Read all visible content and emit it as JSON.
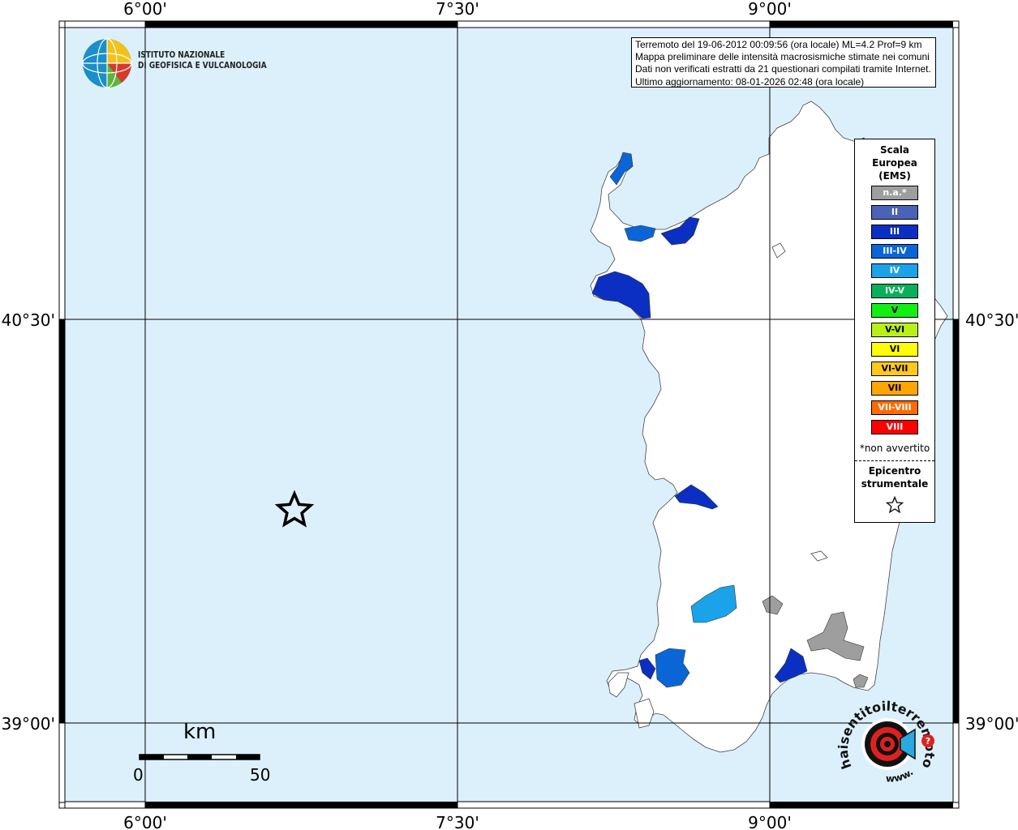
{
  "axes": {
    "lon_labels": [
      "6°00'",
      "7°30'",
      "9°00'"
    ],
    "lat_labels": [
      "40°30'",
      "39°00'"
    ]
  },
  "colors": {
    "sea": "#dcf0fc",
    "land": "#ffffff",
    "frame": "#000000",
    "grid": "#000000"
  },
  "logo": {
    "line1": "ISTITUTO NAZIONALE",
    "line2": "DI GEOFISICA E VULCANOLOGIA"
  },
  "info": {
    "line1": "Terremoto del 19-06-2012 00:09:56 (ora locale) ML=4.2 Prof=9 km",
    "line2": "Mappa preliminare delle intensità macrosismiche stimate nei comuni",
    "line3": "Dati non verificati estratti da 21 questionari compilati tramite Internet.",
    "line4": "Ultimo aggiornamento: 08-01-2026 02:48 (ora locale)"
  },
  "legend": {
    "title_line1": "Scala",
    "title_line2": "Europea",
    "title_line3": "(EMS)",
    "items": [
      {
        "label": "n.a.*",
        "color": "#9e9e9e"
      },
      {
        "label": "II",
        "color": "#4a63b8"
      },
      {
        "label": "III",
        "color": "#0a2fc2"
      },
      {
        "label": "III-IV",
        "color": "#0a66d6"
      },
      {
        "label": "IV",
        "color": "#1aa3e8"
      },
      {
        "label": "IV-V",
        "color": "#07b05a"
      },
      {
        "label": "V",
        "color": "#12f012"
      },
      {
        "label": "V-VI",
        "color": "#b9f01a"
      },
      {
        "label": "VI",
        "color": "#ffff00"
      },
      {
        "label": "VI-VII",
        "color": "#ffc81a"
      },
      {
        "label": "VII",
        "color": "#ffa500"
      },
      {
        "label": "VII-VIII",
        "color": "#ff6a00"
      },
      {
        "label": "VIII",
        "color": "#ff0000"
      }
    ],
    "note": "*non avvertito",
    "epicenter_line1": "Epicentro",
    "epicenter_line2": "strumentale",
    "star_icon": "star-outline-icon"
  },
  "scale_bar": {
    "unit": "km",
    "start": "0",
    "end": "50"
  },
  "epicenter": {
    "icon": "star-outline-icon"
  },
  "intensity_areas": [
    {
      "intensity": "III-IV"
    },
    {
      "intensity": "III"
    },
    {
      "intensity": "IV"
    },
    {
      "intensity": "n.a.*"
    }
  ],
  "watermark": {
    "text": "haisentitoilterremoto.it",
    "url_text": "www.",
    "icon": "haisentito-logo-icon"
  }
}
